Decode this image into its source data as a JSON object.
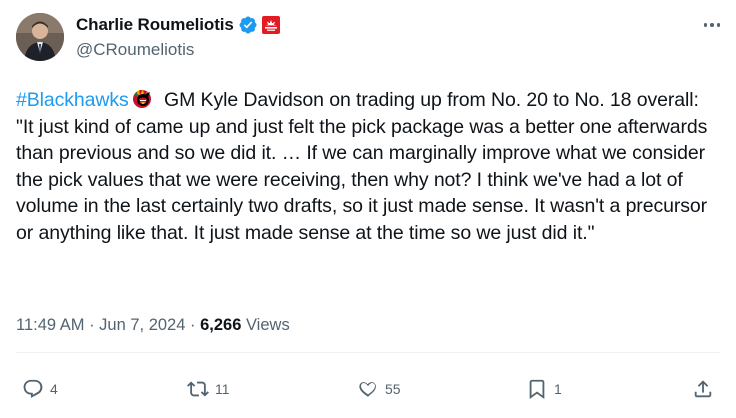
{
  "author": {
    "display_name": "Charlie Roumeliotis",
    "handle": "@CRoumeliotis",
    "verified": true,
    "affiliate_badge_color": "#e31b23"
  },
  "tweet": {
    "hashtag": "#Blackhawks",
    "body": " GM Kyle Davidson on trading up from No. 20 to No. 18 overall: \"It just kind of came up and just felt the pick package was a better one afterwards than previous and so we did it. … If we can marginally improve what we consider the pick values that we were receiving, then why not? I think we've had a lot of volume in the last certainly two drafts, so it just made sense. It wasn't a precursor or anything like that. It just made sense at the time so we just did it.\""
  },
  "meta": {
    "time": "11:49 AM",
    "sep1": " · ",
    "date": "Jun 7, 2024",
    "sep2": " · ",
    "views_count": "6,266",
    "views_label": " Views"
  },
  "actions": {
    "replies": "4",
    "reposts": "11",
    "likes": "55",
    "bookmarks": "1"
  },
  "colors": {
    "accent": "#1d9bf0",
    "text": "#0f1419",
    "muted": "#536471"
  },
  "icons": [
    "verified-icon",
    "network-badge-icon",
    "more-icon",
    "reply-icon",
    "repost-icon",
    "like-icon",
    "bookmark-icon",
    "share-icon",
    "blackhawks-emoji-icon"
  ]
}
